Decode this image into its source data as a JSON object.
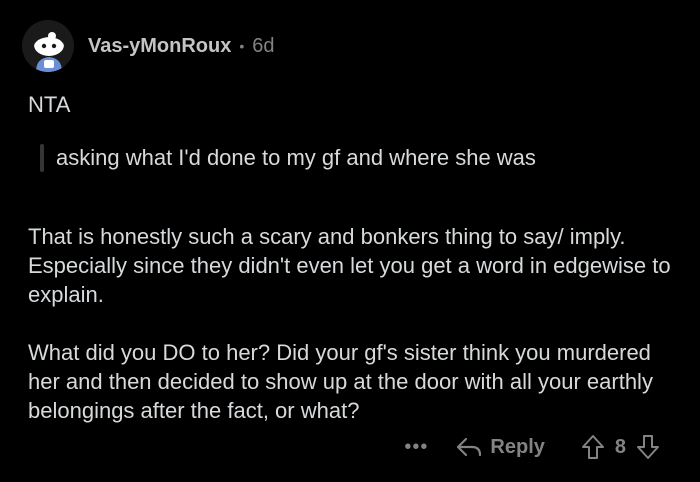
{
  "comment": {
    "username": "Vas-yMonRoux",
    "separator": "•",
    "age": "6d",
    "verdict": "NTA",
    "quote": "asking what I'd done to my gf and where she was",
    "paragraphs": [
      "That is honestly such a scary and bonkers thing to say/ imply. Especially since they didn't even let you get a word in edgewise to explain.",
      "What did you DO to her? Did your gf's sister think you murdered her and then decided to show up at the door with all your earthly belongings after the fact, or what?"
    ],
    "actions": {
      "more_label": "•••",
      "reply_label": "Reply",
      "score": "8",
      "reply_icon": "reply-arrow-icon",
      "upvote_icon": "upvote-arrow-icon",
      "downvote_icon": "downvote-arrow-icon"
    }
  },
  "colors": {
    "background": "#000000",
    "text": "#d7dadc",
    "meta": "#818384",
    "quote_bar": "#343536"
  }
}
